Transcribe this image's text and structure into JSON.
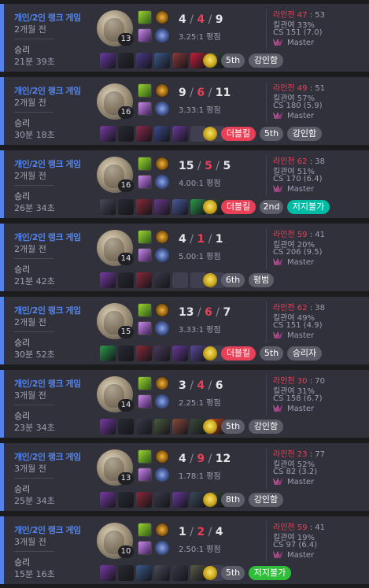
{
  "common": {
    "tier_label": "Master"
  },
  "palette": {
    "bg": "#1c1c1f",
    "card": "#31313c",
    "win_blue": "#5383e8",
    "death_red": "#e84057",
    "badge_gray": "#5d5d69",
    "badge_green": "#2fbd3a"
  },
  "matches": [
    {
      "queue": "개인/2인 랭크 게임",
      "ago": "2개월 전",
      "result": "승리",
      "duration": "21분 39초",
      "level": "13",
      "kda": {
        "k": "4",
        "d": "4",
        "a": "9"
      },
      "ratio": "3.25:1 평점",
      "lane": {
        "label": "라인전",
        "score": "47",
        "opp": "53"
      },
      "kp": "킬관여 33%",
      "cs": "CS 151 (7.0)",
      "items": [
        "#6b3aa8",
        "#2a2a34",
        "#4b3a8a",
        "#3c5a8a",
        "#8a3a3a",
        "#c4203a",
        "#3a4a3a"
      ],
      "badges": [
        {
          "text": "5th",
          "style": "gray",
          "w": 30
        },
        {
          "text": "강인함",
          "style": "gray",
          "w": 44
        }
      ]
    },
    {
      "queue": "개인/2인 랭크 게임",
      "ago": "2개월 전",
      "result": "승리",
      "duration": "30분 18초",
      "level": "16",
      "kda": {
        "k": "9",
        "d": "6",
        "a": "11"
      },
      "ratio": "3.33:1 평점",
      "lane": {
        "label": "라인전",
        "score": "49",
        "opp": "51"
      },
      "kp": "킬관여 57%",
      "cs": "CS 180 (5.9)",
      "items": [
        "#7a3aa8",
        "#2a2a34",
        "#8a2a4a",
        "#3a4a8a",
        "#6a3a9a",
        "empty",
        "empty"
      ],
      "badges": [
        {
          "text": "더블킬",
          "style": "red",
          "w": 44
        },
        {
          "text": "5th",
          "style": "gray",
          "w": 30
        },
        {
          "text": "강인함",
          "style": "gray",
          "w": 44
        }
      ]
    },
    {
      "queue": "개인/2인 랭크 게임",
      "ago": "2개월 전",
      "result": "승리",
      "duration": "26분 34초",
      "level": "16",
      "kda": {
        "k": "15",
        "d": "5",
        "a": "5"
      },
      "ratio": "4.00:1 평점",
      "lane": {
        "label": "라인전",
        "score": "62",
        "opp": "38"
      },
      "kp": "킬관여 51%",
      "cs": "CS 170 (6.4)",
      "items": [
        "#4a4a5a",
        "#2a2a34",
        "#8a2a3a",
        "#6a3a8a",
        "#4a5a9a",
        "#2a9a4a",
        "#3a4a3a"
      ],
      "badges": [
        {
          "text": "더블킬",
          "style": "red",
          "w": 44
        },
        {
          "text": "2nd",
          "style": "gray",
          "w": 30
        },
        {
          "text": "저지불가",
          "style": "green",
          "w": 54
        }
      ]
    },
    {
      "queue": "개인/2인 랭크 게임",
      "ago": "2개월 전",
      "result": "승리",
      "duration": "21분 42초",
      "level": "14",
      "kda": {
        "k": "4",
        "d": "1",
        "a": "1"
      },
      "ratio": "5.00:1 평점",
      "lane": {
        "label": "라인전",
        "score": "59",
        "opp": "41"
      },
      "kp": "킬관여 20%",
      "cs": "CS 206 (9.5)",
      "items": [
        "#7a3aa8",
        "#2a2a34",
        "#8a2a3a",
        "#3a3a4a",
        "empty",
        "empty",
        "empty"
      ],
      "badges": [
        {
          "text": "6th",
          "style": "gray",
          "w": 30
        },
        {
          "text": "평범",
          "style": "gray",
          "w": 32
        }
      ]
    },
    {
      "queue": "개인/2인 랭크 게임",
      "ago": "2개월 전",
      "result": "승리",
      "duration": "30분 52초",
      "level": "15",
      "kda": {
        "k": "13",
        "d": "6",
        "a": "7"
      },
      "ratio": "3.33:1 평점",
      "lane": {
        "label": "라인전",
        "score": "62",
        "opp": "38"
      },
      "kp": "킬관여 49%",
      "cs": "CS 151 (4.9)",
      "items": [
        "#2a9a4a",
        "#2a2a34",
        "#8a2a3a",
        "#4a3a5a",
        "#6a3a9a",
        "#5a4a9a",
        "empty"
      ],
      "badges": [
        {
          "text": "더블킬",
          "style": "red",
          "w": 44
        },
        {
          "text": "5th",
          "style": "gray",
          "w": 30
        },
        {
          "text": "승리자",
          "style": "gray",
          "w": 44
        }
      ]
    },
    {
      "queue": "개인/2인 랭크 게임",
      "ago": "3개월 전",
      "result": "승리",
      "duration": "23분 34초",
      "level": "14",
      "kda": {
        "k": "3",
        "d": "4",
        "a": "6"
      },
      "ratio": "2.25:1 평점",
      "lane": {
        "label": "라인전",
        "score": "30",
        "opp": "70"
      },
      "kp": "킬관여 31%",
      "cs": "CS 158 (6.7)",
      "items": [
        "#7a3aa8",
        "#2a2a34",
        "#3a3a4a",
        "#4a5a3a",
        "#8a4a3a",
        "#3a4a3a",
        "#c84a1a"
      ],
      "badges": [
        {
          "text": "5th",
          "style": "gray",
          "w": 30
        },
        {
          "text": "강인함",
          "style": "gray",
          "w": 44
        }
      ]
    },
    {
      "queue": "개인/2인 랭크 게임",
      "ago": "3개월 전",
      "result": "승리",
      "duration": "25분 34초",
      "level": "13",
      "kda": {
        "k": "4",
        "d": "9",
        "a": "12"
      },
      "ratio": "1.78:1 평점",
      "lane": {
        "label": "라인전",
        "score": "23",
        "opp": "77"
      },
      "kp": "킬관여 52%",
      "cs": "CS 82 (3.2)",
      "items": [
        "#7a3aa8",
        "#2a2a34",
        "#8a2a3a",
        "#3a3a4a",
        "#6a3a9a",
        "#3a4a5a",
        "#3a4a3a"
      ],
      "badges": [
        {
          "text": "8th",
          "style": "gray",
          "w": 30
        },
        {
          "text": "강인함",
          "style": "gray",
          "w": 44
        }
      ]
    },
    {
      "queue": "개인/2인 랭크 게임",
      "ago": "3개월 전",
      "result": "승리",
      "duration": "15분 16초",
      "level": "10",
      "kda": {
        "k": "1",
        "d": "2",
        "a": "4"
      },
      "ratio": "2.50:1 평점",
      "lane": {
        "label": "라인전",
        "score": "59",
        "opp": "41"
      },
      "kp": "킬관여 19%",
      "cs": "CS 97 (6.4)",
      "items": [
        "#7a3aa8",
        "#2a2a34",
        "#3a5a8a",
        "#4a4a5a",
        "#3a3a4a",
        "#5a5a4a",
        "empty"
      ],
      "badges": [
        {
          "text": "5th",
          "style": "gray",
          "w": 30
        },
        {
          "text": "저지불가",
          "style": "green2",
          "w": 54
        }
      ]
    }
  ]
}
